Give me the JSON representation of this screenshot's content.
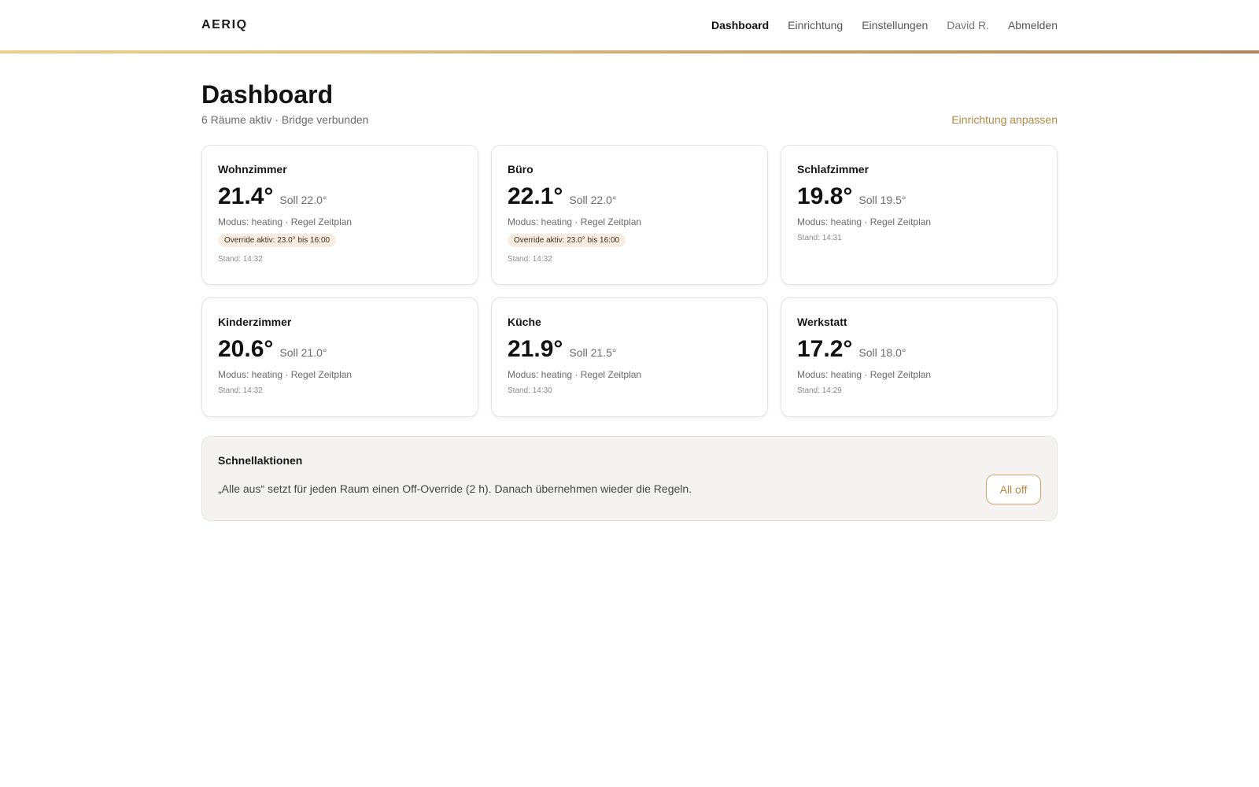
{
  "brand": {
    "name": "AERIQ"
  },
  "nav": {
    "items": [
      {
        "label": "Dashboard"
      },
      {
        "label": "Einrichtung"
      },
      {
        "label": "Einstellungen"
      },
      {
        "label": "David R."
      },
      {
        "label": "Abmelden"
      }
    ],
    "active": "Dashboard"
  },
  "page": {
    "title": "Dashboard",
    "subtitle": "6 Räume aktiv · Bridge verbunden",
    "adjust_link": "Einrichtung anpassen"
  },
  "rooms": [
    {
      "name": "Wohnzimmer",
      "current": "21.4°",
      "target": "Soll 22.0°",
      "mode": "Modus: heating · Regel Zeitplan",
      "override": "Override aktiv: 23.0° bis 16:00",
      "stamp": "Stand: 14:32"
    },
    {
      "name": "Büro",
      "current": "22.1°",
      "target": "Soll 22.0°",
      "mode": "Modus: heating · Regel Zeitplan",
      "override": "Override aktiv: 23.0° bis 16:00",
      "stamp": "Stand: 14:32"
    },
    {
      "name": "Schlafzimmer",
      "current": "19.8°",
      "target": "Soll 19.5°",
      "mode": "Modus: heating · Regel Zeitplan",
      "override": null,
      "stamp": "Stand: 14:31"
    },
    {
      "name": "Kinderzimmer",
      "current": "20.6°",
      "target": "Soll 21.0°",
      "mode": "Modus: heating · Regel Zeitplan",
      "override": null,
      "stamp": "Stand: 14:32"
    },
    {
      "name": "Küche",
      "current": "21.9°",
      "target": "Soll 21.5°",
      "mode": "Modus: heating · Regel Zeitplan",
      "override": null,
      "stamp": "Stand: 14:30"
    },
    {
      "name": "Werkstatt",
      "current": "17.2°",
      "target": "Soll 18.0°",
      "mode": "Modus: heating · Regel Zeitplan",
      "override": null,
      "stamp": "Stand: 14:29"
    }
  ],
  "quick_actions": {
    "title": "Schnellaktionen",
    "description": "„Alle aus“ setzt für jeden Raum einen Off-Override (2 h). Danach übernehmen wieder die Regeln.",
    "all_off_label": "All off"
  },
  "colors": {
    "accent": "#b38a45",
    "gold_start": "#e9d08c",
    "gold_end": "#b0855a",
    "override_bg": "#f8ede0",
    "panel_bg": "#f4f3f1"
  }
}
